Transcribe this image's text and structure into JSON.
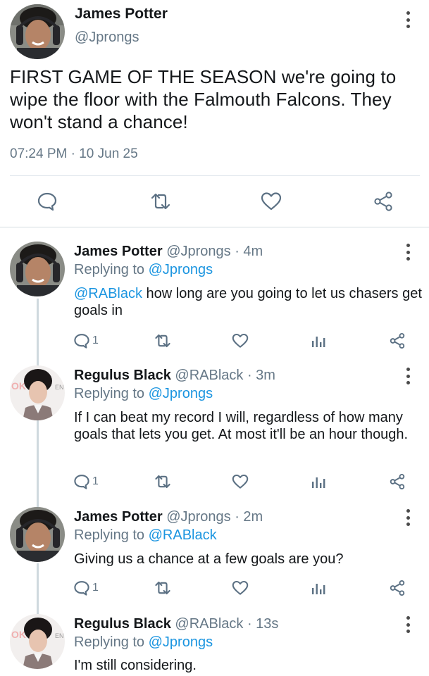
{
  "main_tweet": {
    "name": "James Potter",
    "handle": "@Jprongs",
    "text": "FIRST GAME OF THE SEASON we're going to wipe the floor with the Falmouth Falcons. They won't stand a chance!",
    "timestamp": "07:24 PM · 10 Jun 25",
    "actions": [
      "reply-icon",
      "retweet-icon",
      "like-icon",
      "share-icon"
    ]
  },
  "replies": [
    {
      "name": "James Potter",
      "handle": "@Jprongs",
      "time": "· 4m",
      "replying_prefix": "Replying to ",
      "replying_to": "@Jprongs",
      "mention": "@RABlack",
      "text": " how long are you going to let us chasers get goals in",
      "reply_count": "1"
    },
    {
      "name": "Regulus Black",
      "handle": "@RABlack",
      "time": "· 3m",
      "replying_prefix": "Replying to ",
      "replying_to": "@Jprongs",
      "mention": "",
      "text": "If I can beat my record I will, regardless of how many goals that lets you get. At most it'll be an hour though.",
      "reply_count": "1"
    },
    {
      "name": "James Potter",
      "handle": "@Jprongs",
      "time": "· 2m",
      "replying_prefix": "Replying to ",
      "replying_to": "@RABlack",
      "mention": "",
      "text": "Giving us a chance at a few goals are you?",
      "reply_count": "1"
    },
    {
      "name": "Regulus Black",
      "handle": "@RABlack",
      "time": "· 13s",
      "replying_prefix": "Replying to ",
      "replying_to": "@Jprongs",
      "mention": "",
      "text": "I'm still considering.",
      "reply_count": ""
    }
  ],
  "colors": {
    "link": "#1b95e0",
    "secondary_text": "#657786",
    "primary_text": "#14171a",
    "icon": "#5b7083",
    "divider": "#e1e8ed"
  },
  "reply_actions": [
    "reply-icon",
    "retweet-icon",
    "like-icon",
    "analytics-icon",
    "share-icon"
  ]
}
